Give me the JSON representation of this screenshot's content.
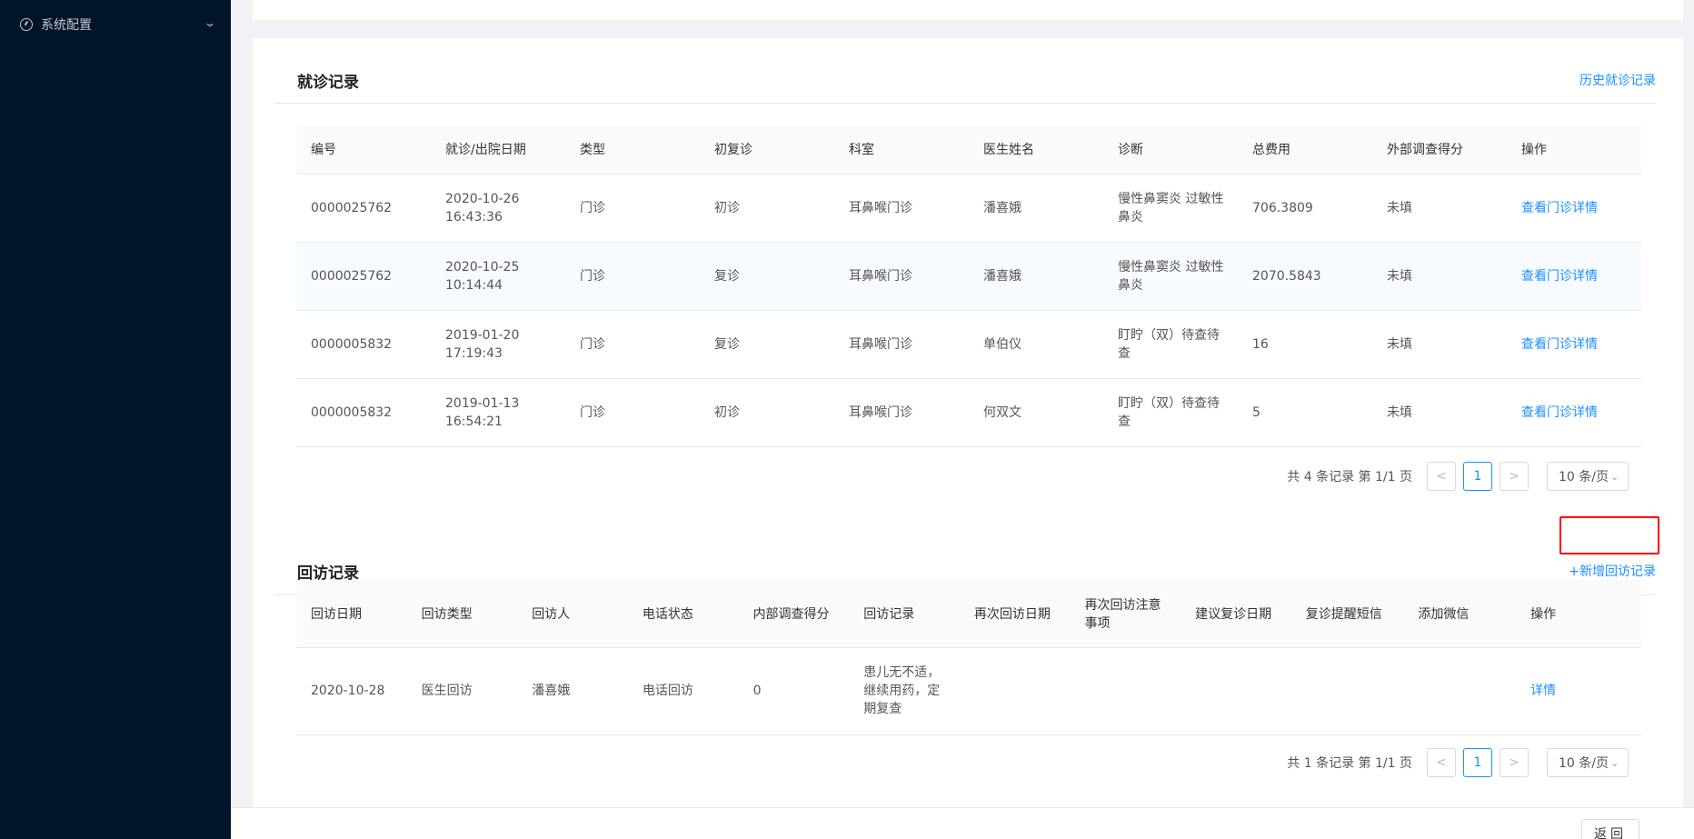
{
  "sidebar": {
    "item_label": "系统配置",
    "item_icon": "dashboard-icon"
  },
  "visits": {
    "title": "就诊记录",
    "history_link": "历史就诊记录",
    "columns": [
      "编号",
      "就诊/出院日期",
      "类型",
      "初复诊",
      "科室",
      "医生姓名",
      "诊断",
      "总费用",
      "外部调查得分",
      "操作"
    ],
    "rows": [
      {
        "id": "0000025762",
        "date": "2020-10-26",
        "time": "16:43:36",
        "type": "门诊",
        "visit": "初诊",
        "dept": "耳鼻喉门诊",
        "doctor": "潘喜娥",
        "diag": "慢性鼻窦炎 过敏性鼻炎",
        "fee": "706.3809",
        "score": "未填",
        "action": "查看门诊详情"
      },
      {
        "id": "0000025762",
        "date": "2020-10-25",
        "time": "10:14:44",
        "type": "门诊",
        "visit": "复诊",
        "dept": "耳鼻喉门诊",
        "doctor": "潘喜娥",
        "diag": "慢性鼻窦炎 过敏性鼻炎",
        "fee": "2070.5843",
        "score": "未填",
        "action": "查看门诊详情"
      },
      {
        "id": "0000005832",
        "date": "2019-01-20",
        "time": "17:19:43",
        "type": "门诊",
        "visit": "复诊",
        "dept": "耳鼻喉门诊",
        "doctor": "单伯仪",
        "diag": "盯眝（双）待查待查",
        "fee": "16",
        "score": "未填",
        "action": "查看门诊详情"
      },
      {
        "id": "0000005832",
        "date": "2019-01-13",
        "time": "16:54:21",
        "type": "门诊",
        "visit": "初诊",
        "dept": "耳鼻喉门诊",
        "doctor": "何双文",
        "diag": "盯眝（双）待查待查",
        "fee": "5",
        "score": "未填",
        "action": "查看门诊详情"
      }
    ],
    "pager": {
      "total": "共 4 条记录 第 1/1 页",
      "prev": "<",
      "current": "1",
      "next": ">",
      "size": "10 条/页"
    }
  },
  "followups": {
    "title": "回访记录",
    "add_link": "+新增回访记录",
    "columns": [
      "回访日期",
      "回访类型",
      "回访人",
      "电话状态",
      "内部调查得分",
      "回访记录",
      "再次回访日期",
      "再次回访注意事项",
      "建议复诊日期",
      "复诊提醒短信",
      "添加微信",
      "操作"
    ],
    "rows": [
      {
        "date": "2020-10-28",
        "type": "医生回访",
        "person": "潘喜娥",
        "phone": "电话回访",
        "score": "0",
        "record": "患儿无不适，继续用药，定期复查",
        "next_date": "",
        "note": "",
        "suggest": "",
        "sms": "",
        "wechat": "",
        "action": "详情"
      }
    ],
    "pager": {
      "total": "共 1 条记录 第 1/1 页",
      "prev": "<",
      "current": "1",
      "next": ">",
      "size": "10 条/页"
    }
  },
  "footer": {
    "back_label": "返回"
  },
  "colors": {
    "primary": "#1890ff",
    "sidebar_bg": "#001529",
    "highlight": "#ff0000"
  }
}
